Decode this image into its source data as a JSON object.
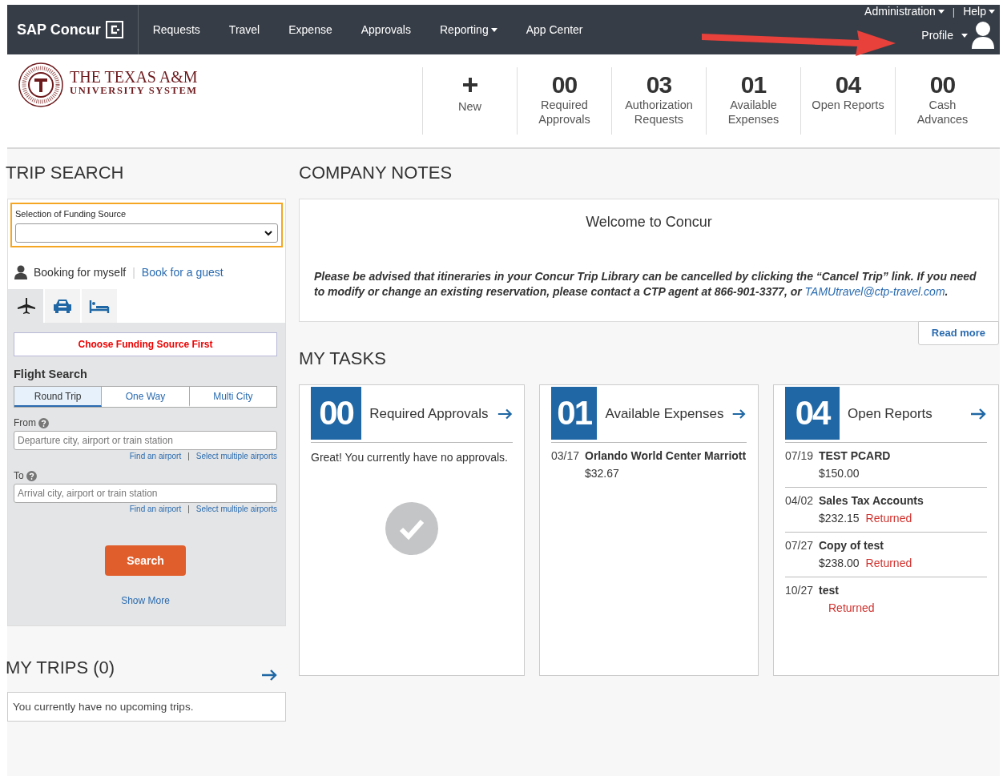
{
  "nav": {
    "brand": "SAP Concur",
    "items": [
      {
        "label": "Requests",
        "dropdown": false
      },
      {
        "label": "Travel",
        "dropdown": false
      },
      {
        "label": "Expense",
        "dropdown": false
      },
      {
        "label": "Approvals",
        "dropdown": false
      },
      {
        "label": "Reporting",
        "dropdown": true
      },
      {
        "label": "App Center",
        "dropdown": false
      }
    ],
    "utility": [
      {
        "label": "Administration"
      },
      {
        "label": "Help"
      }
    ],
    "utility_separator": "|",
    "profile": "Profile"
  },
  "header": {
    "org_line1": "THE TEXAS A&M",
    "org_line2": "UNIVERSITY SYSTEM",
    "tiles": [
      {
        "kind": "action",
        "label": "New"
      },
      {
        "kind": "count",
        "value": "00",
        "label": "Required Approvals"
      },
      {
        "kind": "count",
        "value": "03",
        "label": "Authorization Requests"
      },
      {
        "kind": "count",
        "value": "01",
        "label": "Available Expenses"
      },
      {
        "kind": "count",
        "value": "04",
        "label": "Open Reports"
      },
      {
        "kind": "count",
        "value": "00",
        "label": "Cash Advances"
      }
    ]
  },
  "trip_search": {
    "title": "TRIP SEARCH",
    "funding_label": "Selection of Funding Source",
    "booking_self": "Booking for myself",
    "booking_guest": "Book for a guest",
    "booking_separator": "|",
    "tabs": [
      {
        "kind": "flight",
        "selected": true
      },
      {
        "kind": "car",
        "selected": false
      },
      {
        "kind": "hotel",
        "selected": false
      }
    ],
    "warning": "Choose Funding Source First",
    "section_title": "Flight Search",
    "trip_types": [
      {
        "label": "Round Trip",
        "selected": true
      },
      {
        "label": "One Way",
        "selected": false
      },
      {
        "label": "Multi City",
        "selected": false
      }
    ],
    "fields": [
      {
        "label": "From",
        "placeholder": "Departure city, airport or train station",
        "links": [
          "Find an airport",
          "Select multiple airports"
        ],
        "link_separator": "|"
      },
      {
        "label": "To",
        "placeholder": "Arrival city, airport or train station",
        "links": [
          "Find an airport",
          "Select multiple airports"
        ],
        "link_separator": "|"
      }
    ],
    "search_button": "Search",
    "show_more": "Show More"
  },
  "my_trips": {
    "title": "MY TRIPS (0)",
    "message": "You currently have no upcoming trips."
  },
  "company_notes": {
    "title": "COMPANY NOTES",
    "heading": "Welcome to Concur",
    "body": "Please be advised that itineraries in your Concur Trip Library can be cancelled by clicking the “Cancel Trip” link. If you need to modify or change an existing reservation, please contact a CTP agent at 866-901-3377, or",
    "link": "TAMUtravel@ctp-travel.com",
    "after": ".",
    "read_more": "Read more"
  },
  "my_tasks": {
    "title": "MY TASKS",
    "cards": [
      {
        "count": "00",
        "title": "Required Approvals",
        "message": "Great! You currently have no approvals."
      },
      {
        "count": "01",
        "title": "Available Expenses",
        "items": [
          {
            "date": "03/17",
            "name": "Orlando World Center Marriott",
            "amount": "$32.67"
          }
        ]
      },
      {
        "count": "04",
        "title": "Open Reports",
        "items": [
          {
            "date": "07/19",
            "name": "TEST PCARD",
            "amount": "$150.00"
          },
          {
            "date": "04/02",
            "name": "Sales Tax Accounts",
            "amount": "$232.15",
            "status": "Returned"
          },
          {
            "date": "07/27",
            "name": "Copy of test",
            "amount": "$238.00",
            "status": "Returned"
          },
          {
            "date": "10/27",
            "name": "test",
            "status": "Returned"
          }
        ]
      }
    ]
  }
}
